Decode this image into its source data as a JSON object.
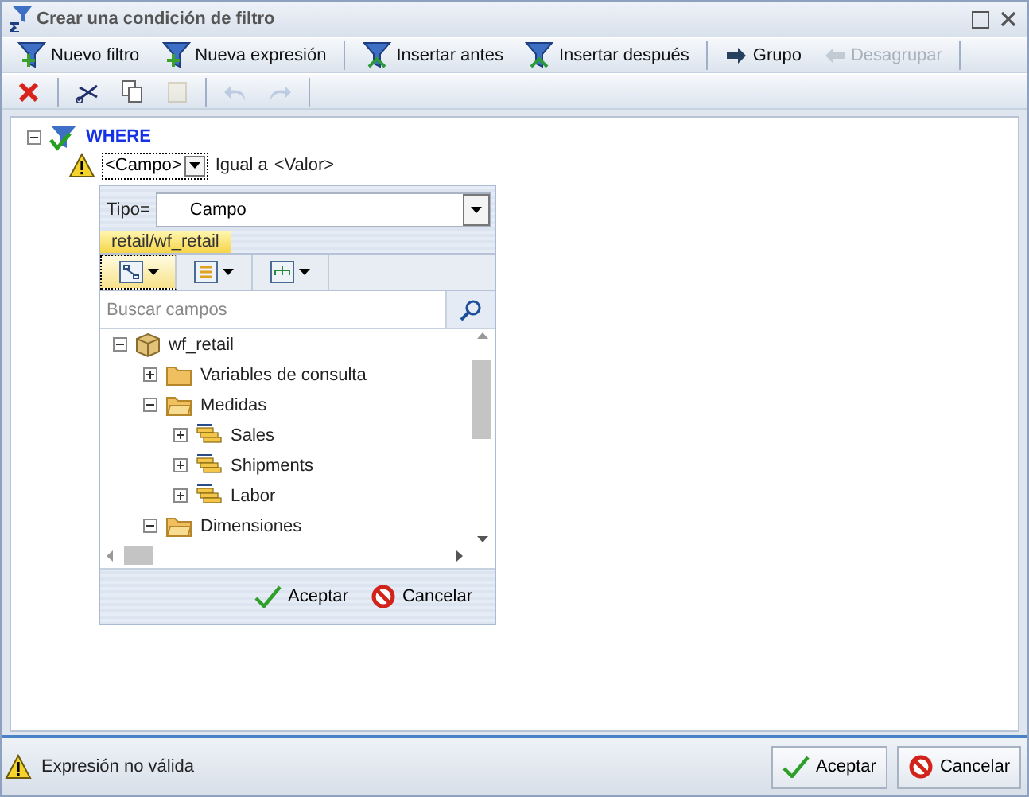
{
  "window": {
    "title": "Crear una condición de filtro"
  },
  "toolbar": [
    {
      "label": "Nuevo filtro",
      "kind": "new",
      "disabled": false
    },
    {
      "label": "Nueva expresión",
      "kind": "new",
      "disabled": false
    },
    {
      "label": "Insertar antes",
      "kind": "insert",
      "disabled": false
    },
    {
      "label": "Insertar después",
      "kind": "insert",
      "disabled": false
    },
    {
      "label": "Grupo",
      "kind": "group",
      "disabled": false
    },
    {
      "label": "Desagrupar",
      "kind": "ungroup",
      "disabled": true
    }
  ],
  "edit_toolbar": [
    {
      "kind": "delete",
      "disabled": false
    },
    {
      "kind": "cut",
      "disabled": false
    },
    {
      "kind": "copy",
      "disabled": false
    },
    {
      "kind": "paste",
      "disabled": true
    },
    {
      "kind": "undo",
      "disabled": true
    },
    {
      "kind": "redo",
      "disabled": true
    }
  ],
  "where": {
    "label": "WHERE",
    "expanded": true
  },
  "condition": {
    "field": "<Campo>",
    "operator": "Igual a",
    "value": "<Valor>"
  },
  "picker": {
    "type_label": "Tipo=",
    "type_value": "Campo",
    "source": "retail/wf_retail",
    "view_buttons": [
      {
        "kind": "tree",
        "selected": true
      },
      {
        "kind": "list",
        "selected": false
      },
      {
        "kind": "hierarchy",
        "selected": false
      }
    ],
    "search": {
      "placeholder": "Buscar campos"
    },
    "tree": [
      {
        "label": "wf_retail",
        "kind": "cube",
        "expanded": true,
        "children": [
          {
            "label": "Variables de consulta",
            "kind": "folder",
            "expanded": false
          },
          {
            "label": "Medidas",
            "kind": "folder",
            "expanded": true,
            "children": [
              {
                "label": "Sales",
                "kind": "measure",
                "expanded": false
              },
              {
                "label": "Shipments",
                "kind": "measure",
                "expanded": false
              },
              {
                "label": "Labor",
                "kind": "measure",
                "expanded": false
              }
            ]
          },
          {
            "label": "Dimensiones",
            "kind": "folder",
            "expanded": true
          }
        ]
      }
    ],
    "buttons": [
      {
        "label": "Aceptar",
        "kind": "ok"
      },
      {
        "label": "Cancelar",
        "kind": "cancel"
      }
    ]
  },
  "status": {
    "message": "Expresión no válida"
  },
  "buttons": [
    {
      "label": "Aceptar",
      "kind": "ok"
    },
    {
      "label": "Cancelar",
      "kind": "cancel"
    }
  ]
}
